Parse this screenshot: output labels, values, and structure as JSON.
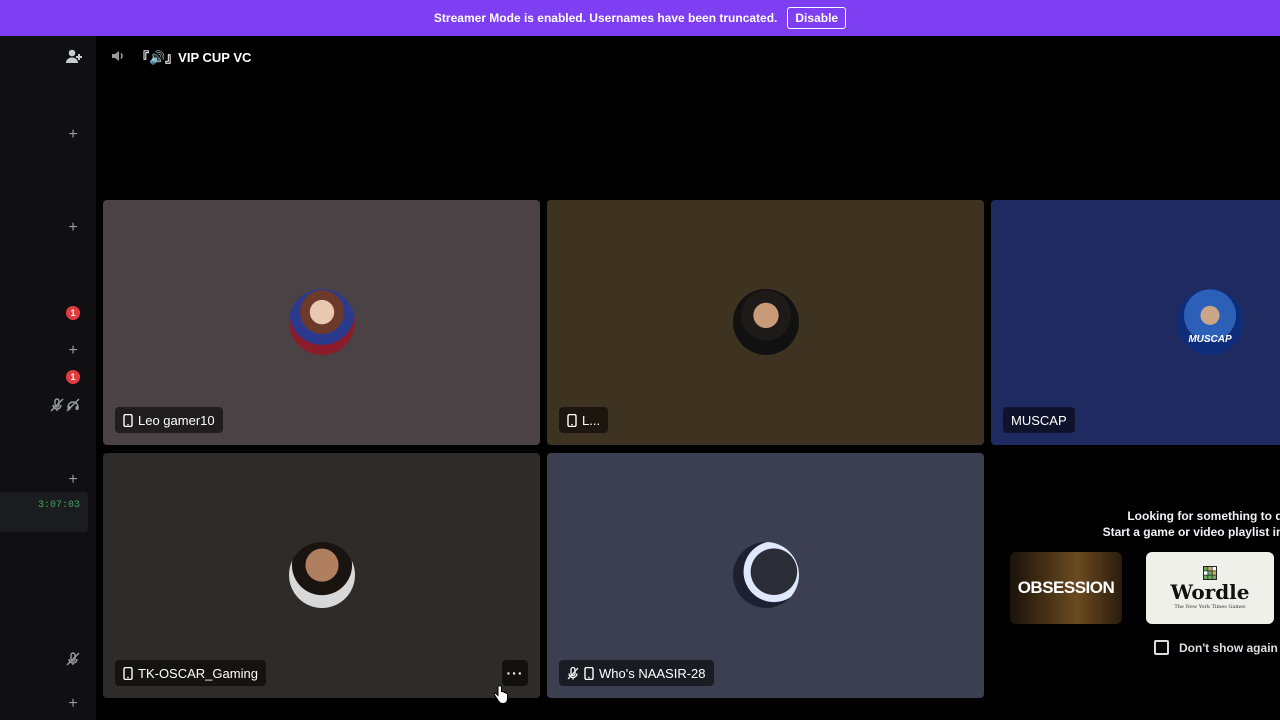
{
  "banner": {
    "message": "Streamer Mode is enabled. Usernames have been truncated.",
    "button_label": "Disable",
    "color": "#7e3ff2"
  },
  "header": {
    "channel_name": "『🔊』VIP CUP VC",
    "channel_name_text": "VIP CUP VC",
    "icons": [
      "add-friend-icon",
      "speaker-icon"
    ]
  },
  "sidebar": {
    "plus_glyph": "+",
    "badges": [
      "1",
      "1"
    ],
    "call_timer": "3:07:03",
    "icons": [
      "add-icon",
      "mute-icon",
      "deafen-icon"
    ]
  },
  "participants": [
    {
      "name": "Leo gamer10",
      "device_icon": "mobile-icon",
      "muted": false,
      "tile_color": "#4a4245"
    },
    {
      "name": "L...",
      "device_icon": "mobile-icon",
      "muted": false,
      "tile_color": "#3e3221"
    },
    {
      "name": "MUSCAP",
      "device_icon": null,
      "muted": false,
      "tile_color": "#1f2a61",
      "avatar_text": "MUSCAP"
    },
    {
      "name": "TK-OSCAR_Gaming",
      "device_icon": "mobile-icon",
      "muted": false,
      "tile_color": "#2e2b29",
      "more_glyph": "···"
    },
    {
      "name": "Who's NAASIR-28",
      "device_icon": "mobile-icon",
      "muted": true,
      "tile_color": "#3c3f4f"
    }
  ],
  "activity_prompt": {
    "line1": "Looking for something to do",
    "line2": "Start a game or video playlist ins",
    "games": [
      {
        "name": "OBSESSION",
        "bg": "#3a2a12"
      },
      {
        "name": "Wordle",
        "subtitle": "The New York Times Games",
        "bg": "#f0f0ea"
      }
    ],
    "dont_show_label": "Don't show again"
  }
}
